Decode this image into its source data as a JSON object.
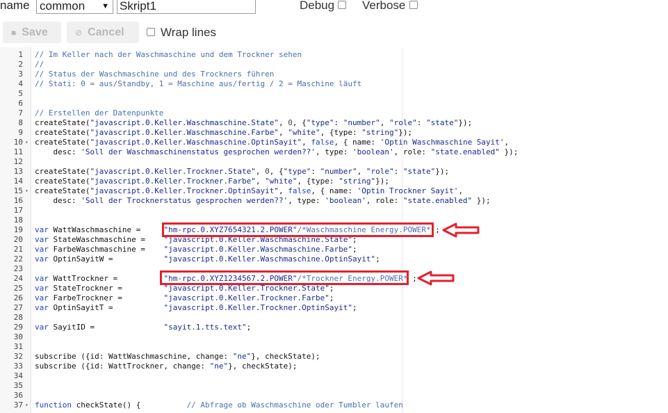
{
  "toolbar_top": {
    "name_label": "name",
    "group_select": "common",
    "script_name": "Skript1",
    "debug_label": "Debug",
    "verbose_label": "Verbose"
  },
  "toolbar": {
    "save_label": "Save",
    "cancel_label": "Cancel",
    "wrap_label": "Wrap lines"
  },
  "editor": {
    "lines": [
      {
        "n": "1",
        "fold": "",
        "tokens": [
          {
            "c": "comment",
            "t": "// Im Keller nach der Waschmaschine und dem Trockner sehen"
          }
        ]
      },
      {
        "n": "2",
        "fold": "",
        "tokens": [
          {
            "c": "comment",
            "t": "//"
          }
        ]
      },
      {
        "n": "3",
        "fold": "",
        "tokens": [
          {
            "c": "comment",
            "t": "// Status der Waschmaschine und des Trockners führen"
          }
        ]
      },
      {
        "n": "4",
        "fold": "",
        "tokens": [
          {
            "c": "comment",
            "t": "// Stati: 0 = aus/Standby, 1 = Maschine aus/fertig / 2 = Maschine läuft"
          }
        ]
      },
      {
        "n": "5",
        "fold": "",
        "tokens": []
      },
      {
        "n": "6",
        "fold": "",
        "tokens": []
      },
      {
        "n": "7",
        "fold": "",
        "tokens": [
          {
            "c": "comment",
            "t": "// Erstellen der Datenpunkte"
          }
        ]
      },
      {
        "n": "8",
        "fold": "",
        "tokens": [
          {
            "c": "fn",
            "t": "createState("
          },
          {
            "c": "string",
            "t": "\"javascript.0.Keller.Waschmaschine.State\""
          },
          {
            "c": "fn",
            "t": ", "
          },
          {
            "c": "number",
            "t": "0"
          },
          {
            "c": "fn",
            "t": ", {"
          },
          {
            "c": "string",
            "t": "\"type\""
          },
          {
            "c": "fn",
            "t": ": "
          },
          {
            "c": "string",
            "t": "\"number\""
          },
          {
            "c": "fn",
            "t": ", "
          },
          {
            "c": "string",
            "t": "\"role\""
          },
          {
            "c": "fn",
            "t": ": "
          },
          {
            "c": "string",
            "t": "\"state\""
          },
          {
            "c": "fn",
            "t": "});"
          }
        ]
      },
      {
        "n": "9",
        "fold": "",
        "tokens": [
          {
            "c": "fn",
            "t": "createState("
          },
          {
            "c": "string",
            "t": "\"javascript.0.Keller.Waschmaschine.Farbe\""
          },
          {
            "c": "fn",
            "t": ", "
          },
          {
            "c": "string",
            "t": "\"white\""
          },
          {
            "c": "fn",
            "t": ", {type: "
          },
          {
            "c": "string",
            "t": "\"string\""
          },
          {
            "c": "fn",
            "t": "});"
          }
        ]
      },
      {
        "n": "10",
        "fold": "▾",
        "tokens": [
          {
            "c": "fn",
            "t": "createState("
          },
          {
            "c": "string",
            "t": "\"javascript.0.Keller.Waschmaschine.OptinSayit\""
          },
          {
            "c": "fn",
            "t": ", "
          },
          {
            "c": "keyword",
            "t": "false"
          },
          {
            "c": "fn",
            "t": ", { name: "
          },
          {
            "c": "string",
            "t": "'Optin Waschmaschine Sayit'"
          },
          {
            "c": "fn",
            "t": ","
          }
        ]
      },
      {
        "n": "11",
        "fold": "",
        "tokens": [
          {
            "c": "fn",
            "t": "    desc: "
          },
          {
            "c": "string",
            "t": "'Soll der Waschmaschinenstatus gesprochen werden??'"
          },
          {
            "c": "fn",
            "t": ", type: "
          },
          {
            "c": "string",
            "t": "'boolean'"
          },
          {
            "c": "fn",
            "t": ", role: "
          },
          {
            "c": "string",
            "t": "\"state.enabled\""
          },
          {
            "c": "fn",
            "t": " });"
          }
        ]
      },
      {
        "n": "12",
        "fold": "",
        "tokens": []
      },
      {
        "n": "13",
        "fold": "",
        "tokens": [
          {
            "c": "fn",
            "t": "createState("
          },
          {
            "c": "string",
            "t": "\"javascript.0.Keller.Trockner.State\""
          },
          {
            "c": "fn",
            "t": ", "
          },
          {
            "c": "number",
            "t": "0"
          },
          {
            "c": "fn",
            "t": ", {"
          },
          {
            "c": "string",
            "t": "\"type\""
          },
          {
            "c": "fn",
            "t": ": "
          },
          {
            "c": "string",
            "t": "\"number\""
          },
          {
            "c": "fn",
            "t": ", "
          },
          {
            "c": "string",
            "t": "\"role\""
          },
          {
            "c": "fn",
            "t": ": "
          },
          {
            "c": "string",
            "t": "\"state\""
          },
          {
            "c": "fn",
            "t": "});"
          }
        ]
      },
      {
        "n": "14",
        "fold": "",
        "tokens": [
          {
            "c": "fn",
            "t": "createState("
          },
          {
            "c": "string",
            "t": "\"javascript.0.Keller.Trockner.Farbe\""
          },
          {
            "c": "fn",
            "t": ", "
          },
          {
            "c": "string",
            "t": "\"white\""
          },
          {
            "c": "fn",
            "t": ", {type: "
          },
          {
            "c": "string",
            "t": "\"string\""
          },
          {
            "c": "fn",
            "t": "});"
          }
        ]
      },
      {
        "n": "15",
        "fold": "▾",
        "tokens": [
          {
            "c": "fn",
            "t": "createState("
          },
          {
            "c": "string",
            "t": "\"javascript.0.Keller.Trockner.OptinSayit\""
          },
          {
            "c": "fn",
            "t": ", "
          },
          {
            "c": "keyword",
            "t": "false"
          },
          {
            "c": "fn",
            "t": ", { name: "
          },
          {
            "c": "string",
            "t": "'Optin Trockner Sayit'"
          },
          {
            "c": "fn",
            "t": ","
          }
        ]
      },
      {
        "n": "16",
        "fold": "",
        "tokens": [
          {
            "c": "fn",
            "t": "    desc: "
          },
          {
            "c": "string",
            "t": "'Soll der Trocknerstatus gesprochen werden??'"
          },
          {
            "c": "fn",
            "t": ", type: "
          },
          {
            "c": "string",
            "t": "'boolean'"
          },
          {
            "c": "fn",
            "t": ", role: "
          },
          {
            "c": "string",
            "t": "\"state.enabled\""
          },
          {
            "c": "fn",
            "t": " });"
          }
        ]
      },
      {
        "n": "17",
        "fold": "",
        "tokens": []
      },
      {
        "n": "18",
        "fold": "",
        "tokens": []
      },
      {
        "n": "19",
        "fold": "",
        "tokens": [
          {
            "c": "keyword",
            "t": "var"
          },
          {
            "c": "fn",
            "t": " WattWaschmaschine =     "
          },
          {
            "c": "string",
            "t": "\"hm-rpc.0.XYZ7654321.2.POWER\""
          },
          {
            "c": "comment",
            "t": "/*Waschmaschine Energy.POWER*"
          },
          {
            "c": "fn",
            "t": " ;"
          }
        ]
      },
      {
        "n": "20",
        "fold": "",
        "tokens": [
          {
            "c": "keyword",
            "t": "var"
          },
          {
            "c": "fn",
            "t": " StateWaschmaschine =    "
          },
          {
            "c": "string",
            "t": "\"javascript.0.Keller.Waschmaschine.State\""
          },
          {
            "c": "fn",
            "t": ";"
          }
        ]
      },
      {
        "n": "21",
        "fold": "",
        "tokens": [
          {
            "c": "keyword",
            "t": "var"
          },
          {
            "c": "fn",
            "t": " FarbeWaschmaschine =    "
          },
          {
            "c": "string",
            "t": "\"javascript.0.Keller.Waschmaschine.Farbe\""
          },
          {
            "c": "fn",
            "t": ";"
          }
        ]
      },
      {
        "n": "22",
        "fold": "",
        "tokens": [
          {
            "c": "keyword",
            "t": "var"
          },
          {
            "c": "fn",
            "t": " OptinSayitW =           "
          },
          {
            "c": "string",
            "t": "\"javascript.0.Keller.Waschmaschine.OptinSayit\""
          },
          {
            "c": "fn",
            "t": ";"
          }
        ]
      },
      {
        "n": "23",
        "fold": "",
        "tokens": []
      },
      {
        "n": "24",
        "fold": "",
        "tokens": [
          {
            "c": "keyword",
            "t": "var"
          },
          {
            "c": "fn",
            "t": " WattTrockner =          "
          },
          {
            "c": "string",
            "t": "\"hm-rpc.0.XYZ1234567.2.POWER\""
          },
          {
            "c": "comment",
            "t": "/*Trockner Energy.POWER*"
          },
          {
            "c": "fn",
            "t": " ;"
          }
        ]
      },
      {
        "n": "25",
        "fold": "",
        "tokens": [
          {
            "c": "keyword",
            "t": "var"
          },
          {
            "c": "fn",
            "t": " StateTrockner =         "
          },
          {
            "c": "string",
            "t": "\"javascript.0.Keller.Trockner.State\""
          },
          {
            "c": "fn",
            "t": ";"
          }
        ]
      },
      {
        "n": "26",
        "fold": "",
        "tokens": [
          {
            "c": "keyword",
            "t": "var"
          },
          {
            "c": "fn",
            "t": " FarbeTrockner =         "
          },
          {
            "c": "string",
            "t": "\"javascript.0.Keller.Trockner.Farbe\""
          },
          {
            "c": "fn",
            "t": ";"
          }
        ]
      },
      {
        "n": "27",
        "fold": "",
        "tokens": [
          {
            "c": "keyword",
            "t": "var"
          },
          {
            "c": "fn",
            "t": " OptinSayitT =           "
          },
          {
            "c": "string",
            "t": "\"javascript.0.Keller.Trockner.OptinSayit\""
          },
          {
            "c": "fn",
            "t": ";"
          }
        ]
      },
      {
        "n": "28",
        "fold": "",
        "tokens": []
      },
      {
        "n": "29",
        "fold": "",
        "tokens": [
          {
            "c": "keyword",
            "t": "var"
          },
          {
            "c": "fn",
            "t": " SayitID =               "
          },
          {
            "c": "string",
            "t": "\"sayit.1.tts.text\""
          },
          {
            "c": "fn",
            "t": ";"
          }
        ]
      },
      {
        "n": "30",
        "fold": "",
        "tokens": []
      },
      {
        "n": "31",
        "fold": "",
        "tokens": []
      },
      {
        "n": "32",
        "fold": "",
        "tokens": [
          {
            "c": "fn",
            "t": "subscribe ({id: WattWaschmaschine, change: "
          },
          {
            "c": "string",
            "t": "\"ne\""
          },
          {
            "c": "fn",
            "t": "}, checkState);"
          }
        ]
      },
      {
        "n": "33",
        "fold": "",
        "tokens": [
          {
            "c": "fn",
            "t": "subscribe ({id: WattTrockner, change: "
          },
          {
            "c": "string",
            "t": "\"ne\""
          },
          {
            "c": "fn",
            "t": "}, checkState);"
          }
        ]
      },
      {
        "n": "34",
        "fold": "",
        "tokens": []
      },
      {
        "n": "35",
        "fold": "",
        "tokens": []
      },
      {
        "n": "36",
        "fold": "",
        "tokens": []
      },
      {
        "n": "37",
        "fold": "▾",
        "tokens": [
          {
            "c": "keyword",
            "t": "function"
          },
          {
            "c": "fn",
            "t": " checkState() {          "
          },
          {
            "c": "comment",
            "t": "// Abfrage ob Waschmaschine oder Tumbler laufen"
          }
        ]
      }
    ]
  },
  "colors": {
    "highlight": "#e3202c",
    "comment": "#4a6fb0",
    "string": "#1a2a8c",
    "keyword": "#1f3fbf"
  }
}
